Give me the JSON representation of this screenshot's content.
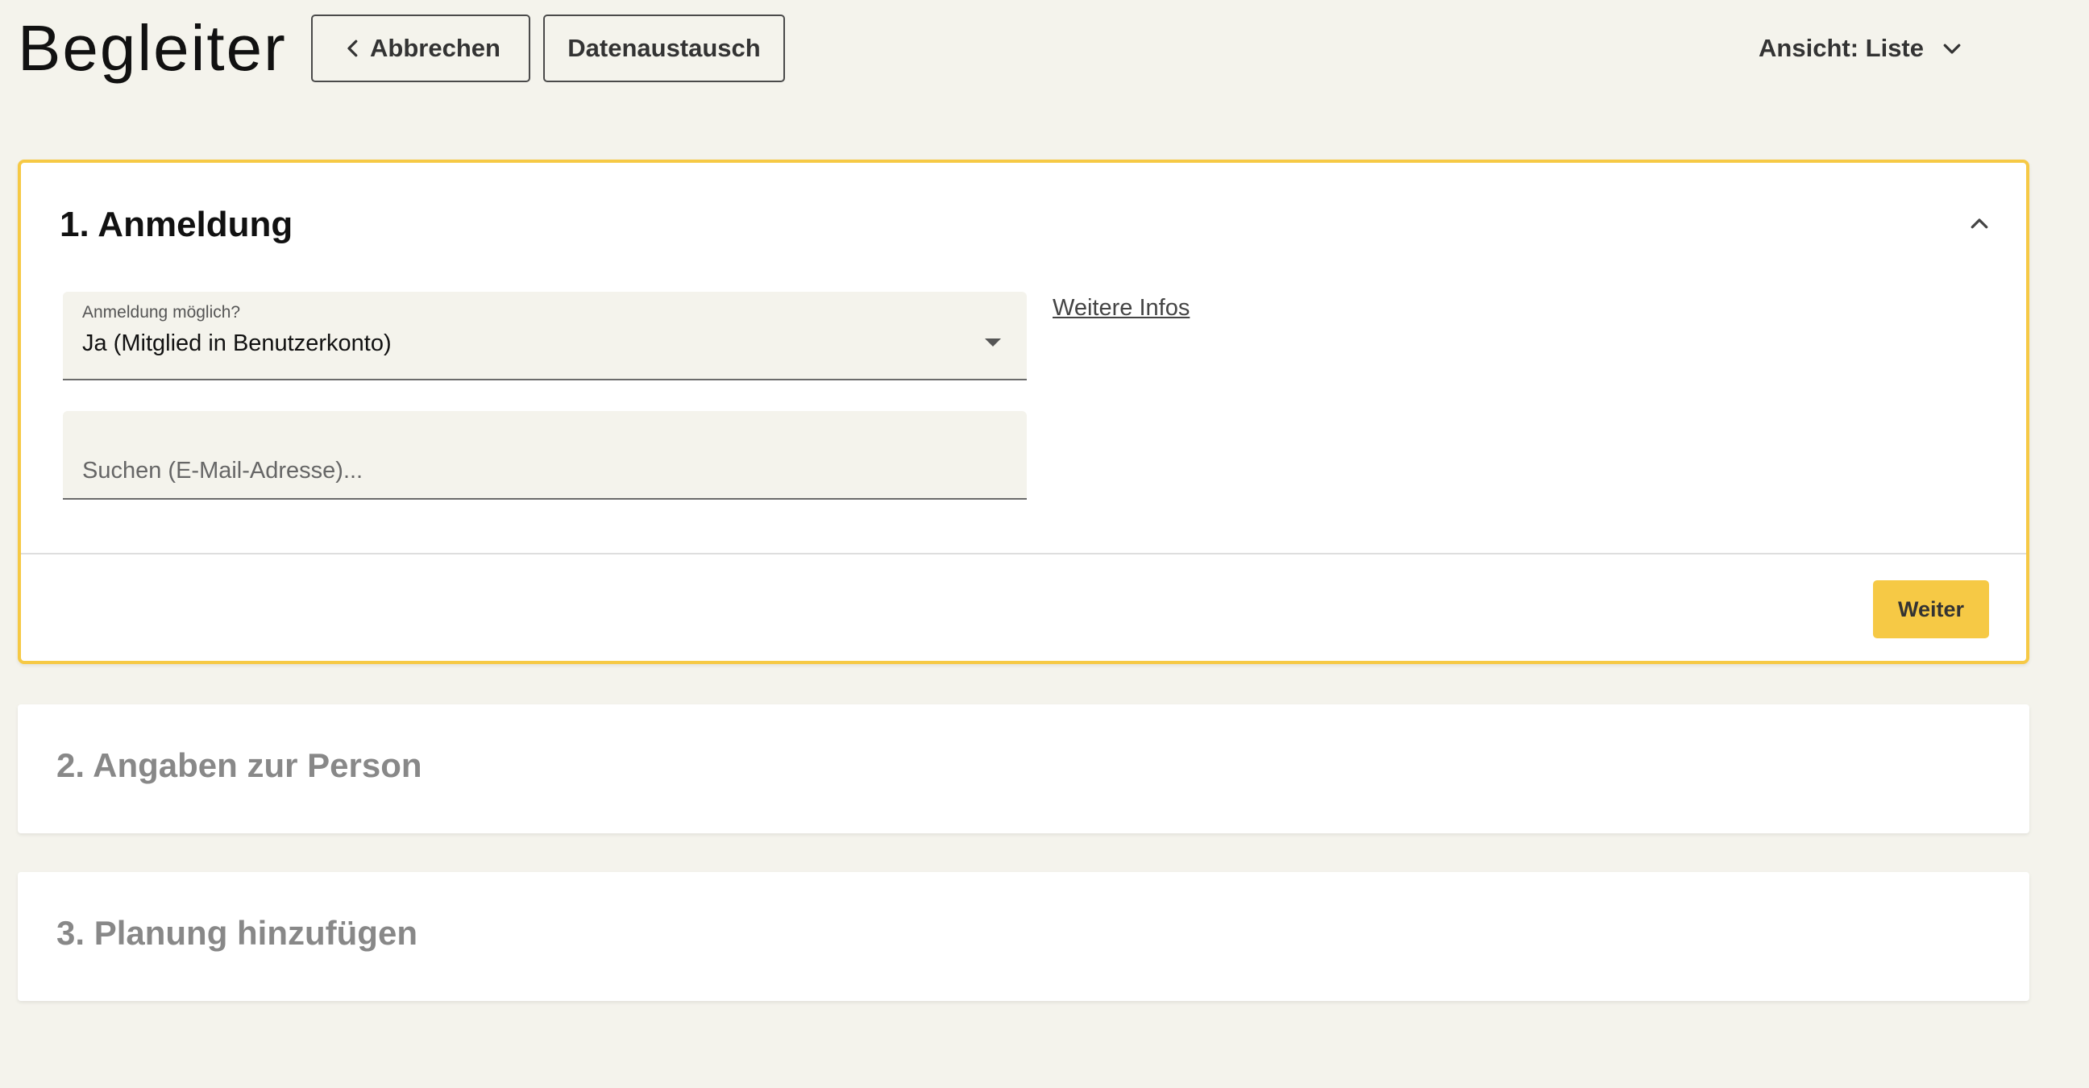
{
  "header": {
    "title": "Begleiter",
    "cancel_label": "Abbrechen",
    "exchange_label": "Datenaustausch",
    "view_label": "Ansicht: Liste"
  },
  "steps": [
    {
      "title": "1. Anmeldung",
      "expanded": true,
      "login_field": {
        "label": "Anmeldung möglich?",
        "value": "Ja (Mitglied in Benutzerkonto)"
      },
      "search_field": {
        "placeholder": "Suchen (E-Mail-Adresse)...",
        "value": ""
      },
      "more_info_label": "Weitere Infos",
      "next_label": "Weiter"
    },
    {
      "title": "2. Angaben zur Person",
      "expanded": false
    },
    {
      "title": "3. Planung hinzufügen",
      "expanded": false
    }
  ],
  "colors": {
    "accent": "#f6c945",
    "background": "#f4f3ec",
    "card": "#ffffff",
    "muted_title": "#888888"
  },
  "icons": {
    "cancel": "chevron-left-icon",
    "view": "chevron-down-icon",
    "collapse": "chevron-up-icon",
    "select": "dropdown-arrow-icon"
  }
}
